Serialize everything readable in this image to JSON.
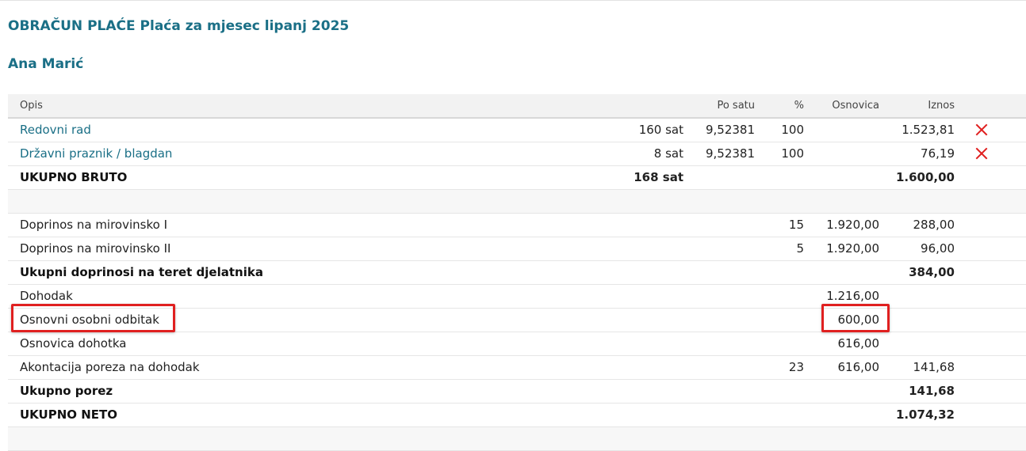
{
  "page": {
    "title": "OBRAČUN PLAĆE Plaća za mjesec lipanj 2025",
    "employee": "Ana Marić"
  },
  "table": {
    "headers": {
      "desc": "Opis",
      "rate": "Po satu",
      "pct": "%",
      "base": "Osnovica",
      "amount": "Iznos"
    },
    "rows": [
      {
        "desc": "Redovni rad",
        "qty": "160 sat",
        "rate": "9,52381",
        "pct": "100",
        "base": "",
        "amount": "1.523,81"
      },
      {
        "desc": "Državni praznik / blagdan",
        "qty": "8 sat",
        "rate": "9,52381",
        "pct": "100",
        "base": "",
        "amount": "76,19"
      },
      {
        "desc": "UKUPNO BRUTO",
        "qty": "168 sat",
        "rate": "",
        "pct": "",
        "base": "",
        "amount": "1.600,00"
      },
      {
        "desc": "",
        "qty": "",
        "rate": "",
        "pct": "",
        "base": "",
        "amount": ""
      },
      {
        "desc": "Doprinos na mirovinsko I",
        "qty": "",
        "rate": "",
        "pct": "15",
        "base": "1.920,00",
        "amount": "288,00"
      },
      {
        "desc": "Doprinos na mirovinsko II",
        "qty": "",
        "rate": "",
        "pct": "5",
        "base": "1.920,00",
        "amount": "96,00"
      },
      {
        "desc": "Ukupni doprinosi na teret djelatnika",
        "qty": "",
        "rate": "",
        "pct": "",
        "base": "",
        "amount": "384,00"
      },
      {
        "desc": "Dohodak",
        "qty": "",
        "rate": "",
        "pct": "",
        "base": "1.216,00",
        "amount": ""
      },
      {
        "desc": "Osnovni osobni odbitak",
        "qty": "",
        "rate": "",
        "pct": "",
        "base": "600,00",
        "amount": ""
      },
      {
        "desc": "Osnovica dohotka",
        "qty": "",
        "rate": "",
        "pct": "",
        "base": "616,00",
        "amount": ""
      },
      {
        "desc": "Akontacija poreza na dohodak",
        "qty": "",
        "rate": "",
        "pct": "23",
        "base": "616,00",
        "amount": "141,68"
      },
      {
        "desc": "Ukupno porez",
        "qty": "",
        "rate": "",
        "pct": "",
        "base": "",
        "amount": "141,68"
      },
      {
        "desc": "UKUPNO NETO",
        "qty": "",
        "rate": "",
        "pct": "",
        "base": "",
        "amount": "1.074,32"
      },
      {
        "desc": "",
        "qty": "",
        "rate": "",
        "pct": "",
        "base": "",
        "amount": ""
      }
    ]
  },
  "icons": {
    "delete": "delete-x-icon"
  },
  "colors": {
    "title": "#1a6f86",
    "link": "#1a6f86",
    "delete": "#e02020",
    "highlight": "#e02020"
  }
}
